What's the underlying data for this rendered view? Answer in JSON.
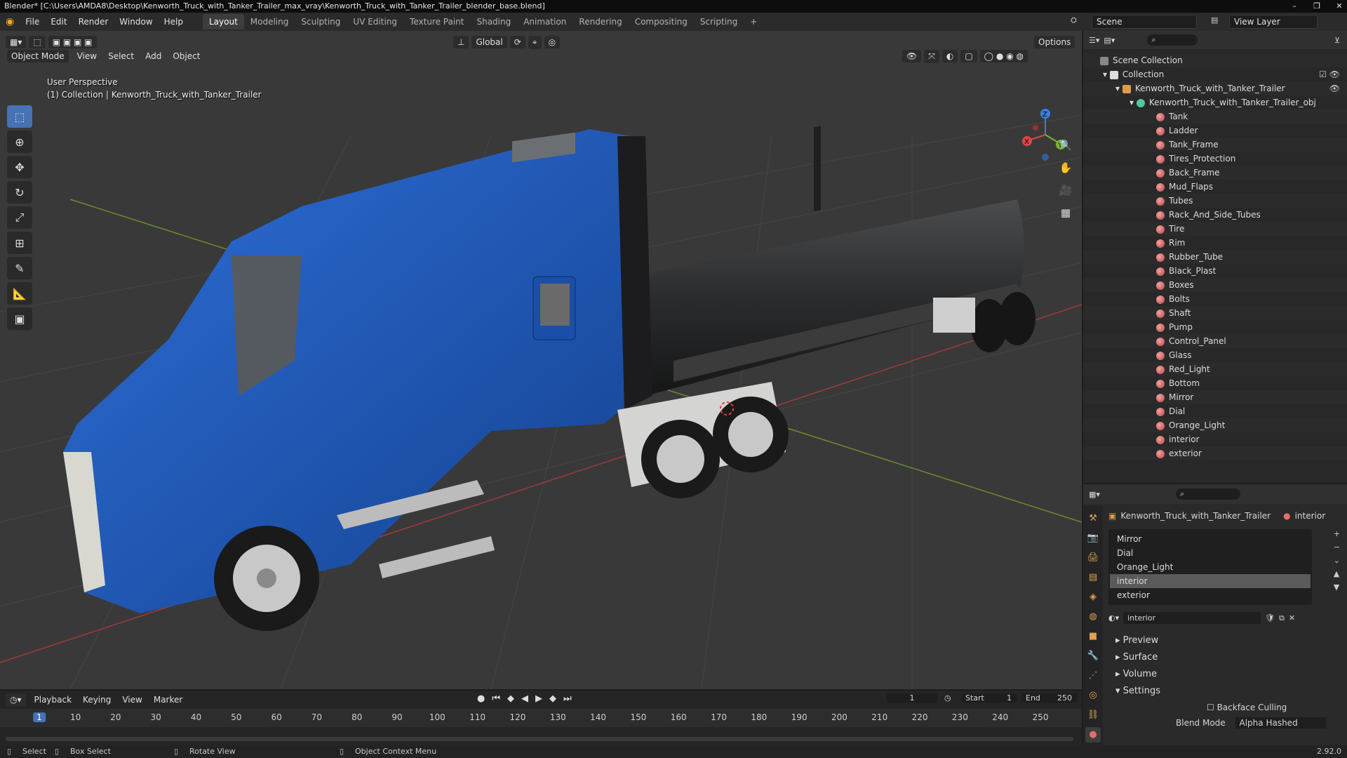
{
  "titlebar": {
    "text": "Blender* [C:\\Users\\AMDA8\\Desktop\\Kenworth_Truck_with_Tanker_Trailer_max_vray\\Kenworth_Truck_with_Tanker_Trailer_blender_base.blend]",
    "minimize": "–",
    "maximize": "❐",
    "close": "✕"
  },
  "menu": [
    "File",
    "Edit",
    "Render",
    "Window",
    "Help"
  ],
  "workspaces": [
    "Layout",
    "Modeling",
    "Sculpting",
    "UV Editing",
    "Texture Paint",
    "Shading",
    "Animation",
    "Rendering",
    "Compositing",
    "Scripting"
  ],
  "add_workspace": "+",
  "scene": "Scene",
  "view_layer": "View Layer",
  "viewport": {
    "mode": "Object Mode",
    "menus": [
      "View",
      "Select",
      "Add",
      "Object"
    ],
    "orientation": "Global",
    "options": "Options",
    "perspective": "User Perspective",
    "collection_info": "(1) Collection | Kenworth_Truck_with_Tanker_Trailer",
    "gizmo": {
      "z": "Z",
      "y": "Y",
      "x": "X"
    },
    "colors": {
      "bg": "#393939",
      "grid": "#454545",
      "x_axis": "#a03a3a",
      "y_axis": "#6c8c2c",
      "truck_blue": "#1d57b8",
      "tank": "#2c2e30"
    }
  },
  "outliner": {
    "root": "Scene Collection",
    "collection": "Collection",
    "object": "Kenworth_Truck_with_Tanker_Trailer",
    "mesh": "Kenworth_Truck_with_Tanker_Trailer_obj",
    "materials": [
      "Tank",
      "Ladder",
      "Tank_Frame",
      "Tires_Protection",
      "Back_Frame",
      "Mud_Flaps",
      "Tubes",
      "Rack_And_Side_Tubes",
      "Tire",
      "Rim",
      "Rubber_Tube",
      "Black_Plast",
      "Boxes",
      "Bolts",
      "Shaft",
      "Pump",
      "Control_Panel",
      "Glass",
      "Red_Light",
      "Bottom",
      "Mirror",
      "Dial",
      "Orange_Light",
      "interior",
      "exterior"
    ]
  },
  "properties": {
    "object": "Kenworth_Truck_with_Tanker_Trailer",
    "active_material": "interior",
    "slots": [
      "Mirror",
      "Dial",
      "Orange_Light",
      "interior",
      "exterior"
    ],
    "selected_slot": "interior",
    "material_name": "interior",
    "panels": [
      "Preview",
      "Surface",
      "Volume",
      "Settings"
    ],
    "backface_culling": "Backface Culling",
    "blend_mode_label": "Blend Mode",
    "blend_mode": "Alpha Hashed"
  },
  "timeline": {
    "menus": [
      "Playback",
      "Keying",
      "View",
      "Marker"
    ],
    "current_frame": "1",
    "start_label": "Start",
    "start": "1",
    "end_label": "End",
    "end": "250",
    "ticks": [
      "1",
      "10",
      "20",
      "30",
      "40",
      "50",
      "60",
      "70",
      "80",
      "90",
      "100",
      "110",
      "120",
      "130",
      "140",
      "150",
      "160",
      "170",
      "180",
      "190",
      "200",
      "210",
      "220",
      "230",
      "240",
      "250"
    ]
  },
  "status": {
    "select": "Select",
    "box_select": "Box Select",
    "rotate": "Rotate View",
    "context": "Object Context Menu",
    "version": "2.92.0"
  }
}
